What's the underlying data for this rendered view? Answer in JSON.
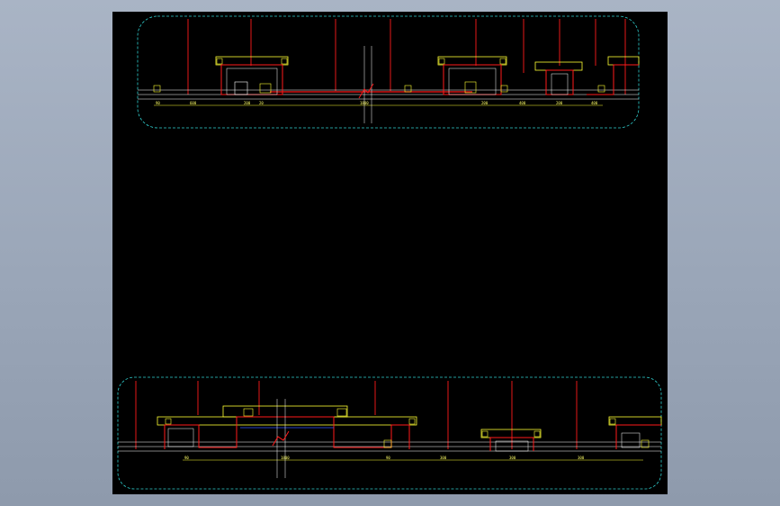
{
  "colors": {
    "background": "#9aa6b8",
    "canvas": "#000000",
    "frame": "#2fd0d0",
    "red": "#ff1a1a",
    "yellow": "#ffff33",
    "white": "#ffffff",
    "blue": "#3355ff"
  },
  "detail_top": {
    "dimension_labels": [
      "90",
      "600",
      "200",
      "20",
      "1800",
      "200",
      "400",
      "200",
      "400"
    ]
  },
  "detail_bottom": {
    "dimension_labels": [
      "90",
      "1800",
      "90",
      "300",
      "300",
      "300"
    ]
  }
}
